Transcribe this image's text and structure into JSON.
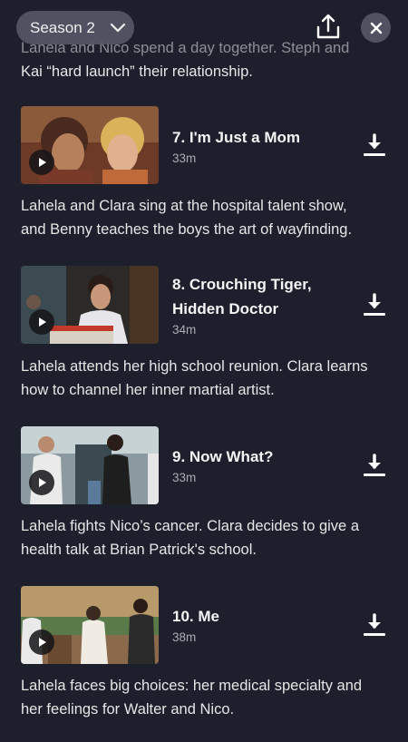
{
  "header": {
    "season_label": "Season 2",
    "chevron_icon": "chevron-down-icon",
    "share_icon": "share-icon",
    "close_icon": "close-icon"
  },
  "previous_description": {
    "line1": "Lahela and Nico spend a day together. Steph and",
    "line2": "Kai “hard launch” their relationship."
  },
  "episodes": [
    {
      "title_line1": "7. I'm Just a Mom",
      "title_line2": "",
      "duration": "33m",
      "description_line1": "Lahela and Clara sing at the hospital talent show,",
      "description_line2": "and Benny teaches the boys the art of wayfinding."
    },
    {
      "title_line1": "8. Crouching Tiger,",
      "title_line2": "Hidden Doctor",
      "duration": "34m",
      "description_line1": "Lahela attends her high school reunion. Clara learns",
      "description_line2": "how to channel her inner martial artist."
    },
    {
      "title_line1": "9. Now What?",
      "title_line2": "",
      "duration": "33m",
      "description_line1": "Lahela fights Nico’s cancer. Clara decides to give a",
      "description_line2": "health talk at Brian Patrick's school."
    },
    {
      "title_line1": "10. Me",
      "title_line2": "",
      "duration": "38m",
      "description_line1": "Lahela faces big choices: her medical specialty and",
      "description_line2": "her feelings for Walter and Nico."
    }
  ],
  "colors": {
    "background": "#1e1f2c",
    "pill": "#555766",
    "secondary_text": "#a9abb5"
  }
}
